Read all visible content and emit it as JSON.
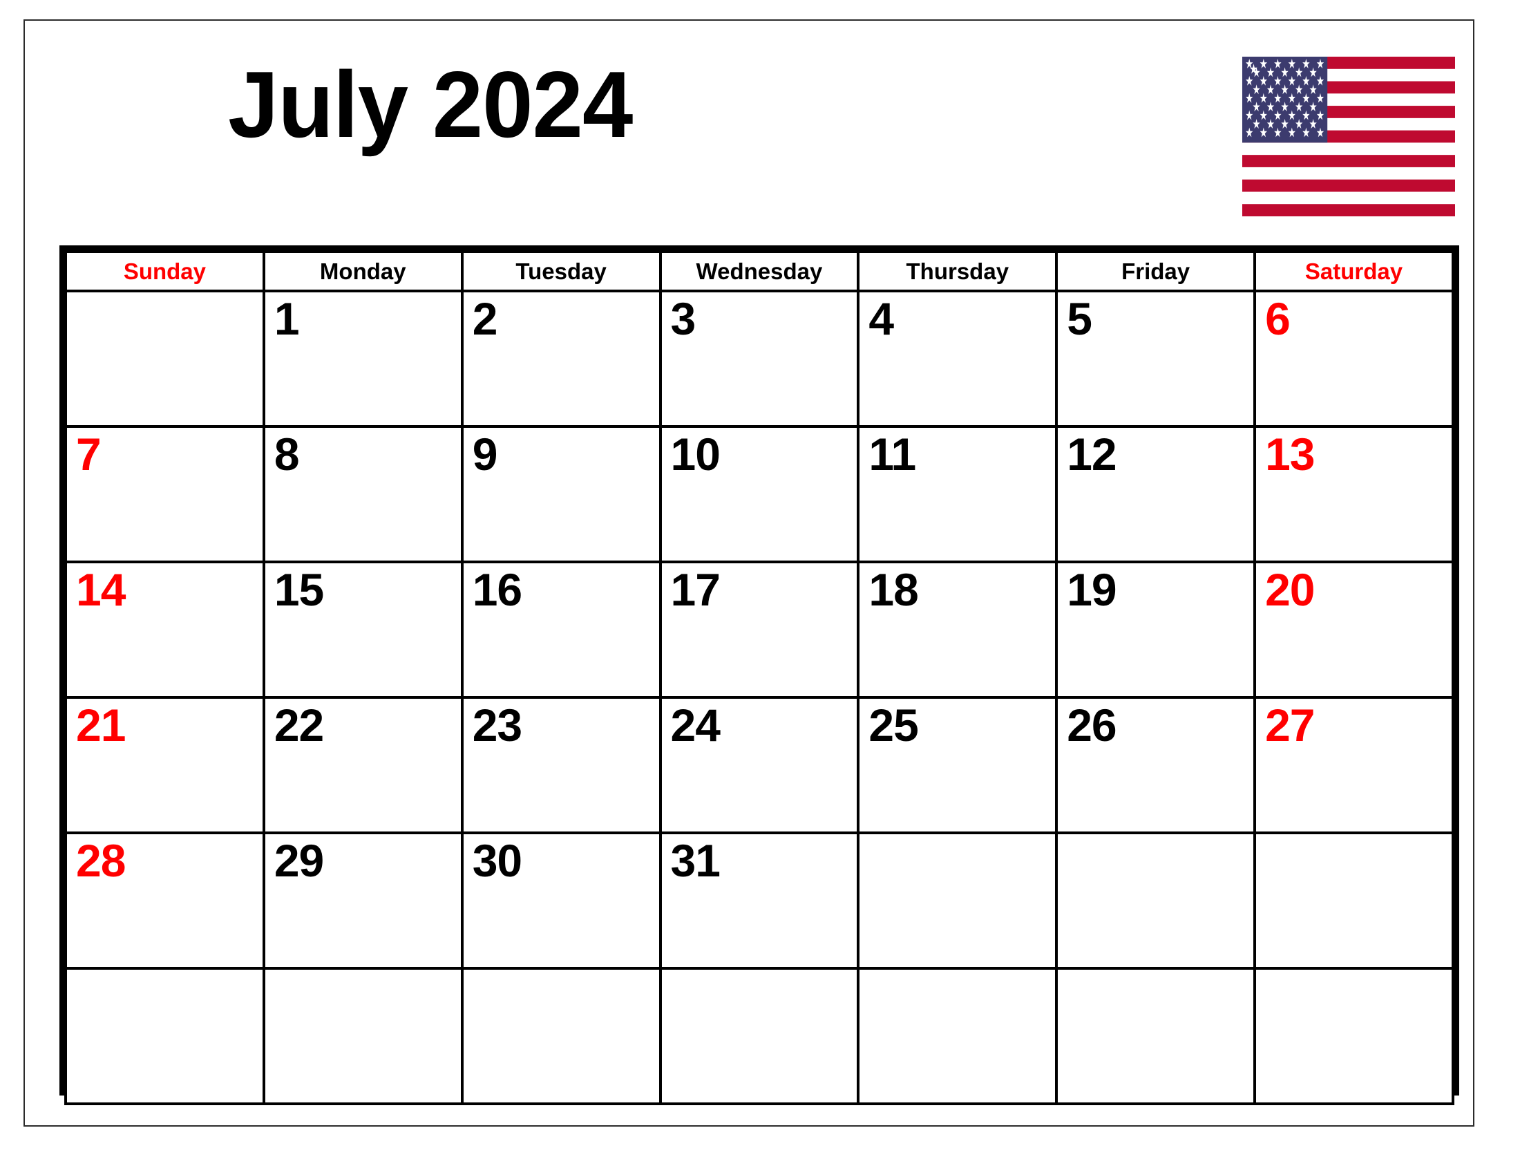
{
  "page": {
    "background_color": "#FFFFFF",
    "border_color": "#2B2B2B"
  },
  "header": {
    "title": "July 2024",
    "month": "July",
    "year": "2024",
    "flag": {
      "name": "united-states-flag",
      "blue": "#3C3B6E",
      "red": "#BF0A30",
      "white": "#FFFFFF",
      "stars": 50,
      "stripes": 13
    }
  },
  "colors": {
    "weekend": "#FF0000",
    "weekday": "#000000",
    "grid_line": "#000000"
  },
  "calendar": {
    "weekdays": [
      {
        "label": "Sunday",
        "weekend": true
      },
      {
        "label": "Monday",
        "weekend": false
      },
      {
        "label": "Tuesday",
        "weekend": false
      },
      {
        "label": "Wednesday",
        "weekend": false
      },
      {
        "label": "Thursday",
        "weekend": false
      },
      {
        "label": "Friday",
        "weekend": false
      },
      {
        "label": "Saturday",
        "weekend": true
      }
    ],
    "weeks": [
      [
        {
          "day": "",
          "weekend": true
        },
        {
          "day": "1",
          "weekend": false
        },
        {
          "day": "2",
          "weekend": false
        },
        {
          "day": "3",
          "weekend": false
        },
        {
          "day": "4",
          "weekend": false
        },
        {
          "day": "5",
          "weekend": false
        },
        {
          "day": "6",
          "weekend": true
        }
      ],
      [
        {
          "day": "7",
          "weekend": true
        },
        {
          "day": "8",
          "weekend": false
        },
        {
          "day": "9",
          "weekend": false
        },
        {
          "day": "10",
          "weekend": false
        },
        {
          "day": "11",
          "weekend": false
        },
        {
          "day": "12",
          "weekend": false
        },
        {
          "day": "13",
          "weekend": true
        }
      ],
      [
        {
          "day": "14",
          "weekend": true
        },
        {
          "day": "15",
          "weekend": false
        },
        {
          "day": "16",
          "weekend": false
        },
        {
          "day": "17",
          "weekend": false
        },
        {
          "day": "18",
          "weekend": false
        },
        {
          "day": "19",
          "weekend": false
        },
        {
          "day": "20",
          "weekend": true
        }
      ],
      [
        {
          "day": "21",
          "weekend": true
        },
        {
          "day": "22",
          "weekend": false
        },
        {
          "day": "23",
          "weekend": false
        },
        {
          "day": "24",
          "weekend": false
        },
        {
          "day": "25",
          "weekend": false
        },
        {
          "day": "26",
          "weekend": false
        },
        {
          "day": "27",
          "weekend": true
        }
      ],
      [
        {
          "day": "28",
          "weekend": true
        },
        {
          "day": "29",
          "weekend": false
        },
        {
          "day": "30",
          "weekend": false
        },
        {
          "day": "31",
          "weekend": false
        },
        {
          "day": "",
          "weekend": false
        },
        {
          "day": "",
          "weekend": false
        },
        {
          "day": "",
          "weekend": true
        }
      ],
      [
        {
          "day": "",
          "weekend": true
        },
        {
          "day": "",
          "weekend": false
        },
        {
          "day": "",
          "weekend": false
        },
        {
          "day": "",
          "weekend": false
        },
        {
          "day": "",
          "weekend": false
        },
        {
          "day": "",
          "weekend": false
        },
        {
          "day": "",
          "weekend": true
        }
      ]
    ]
  }
}
